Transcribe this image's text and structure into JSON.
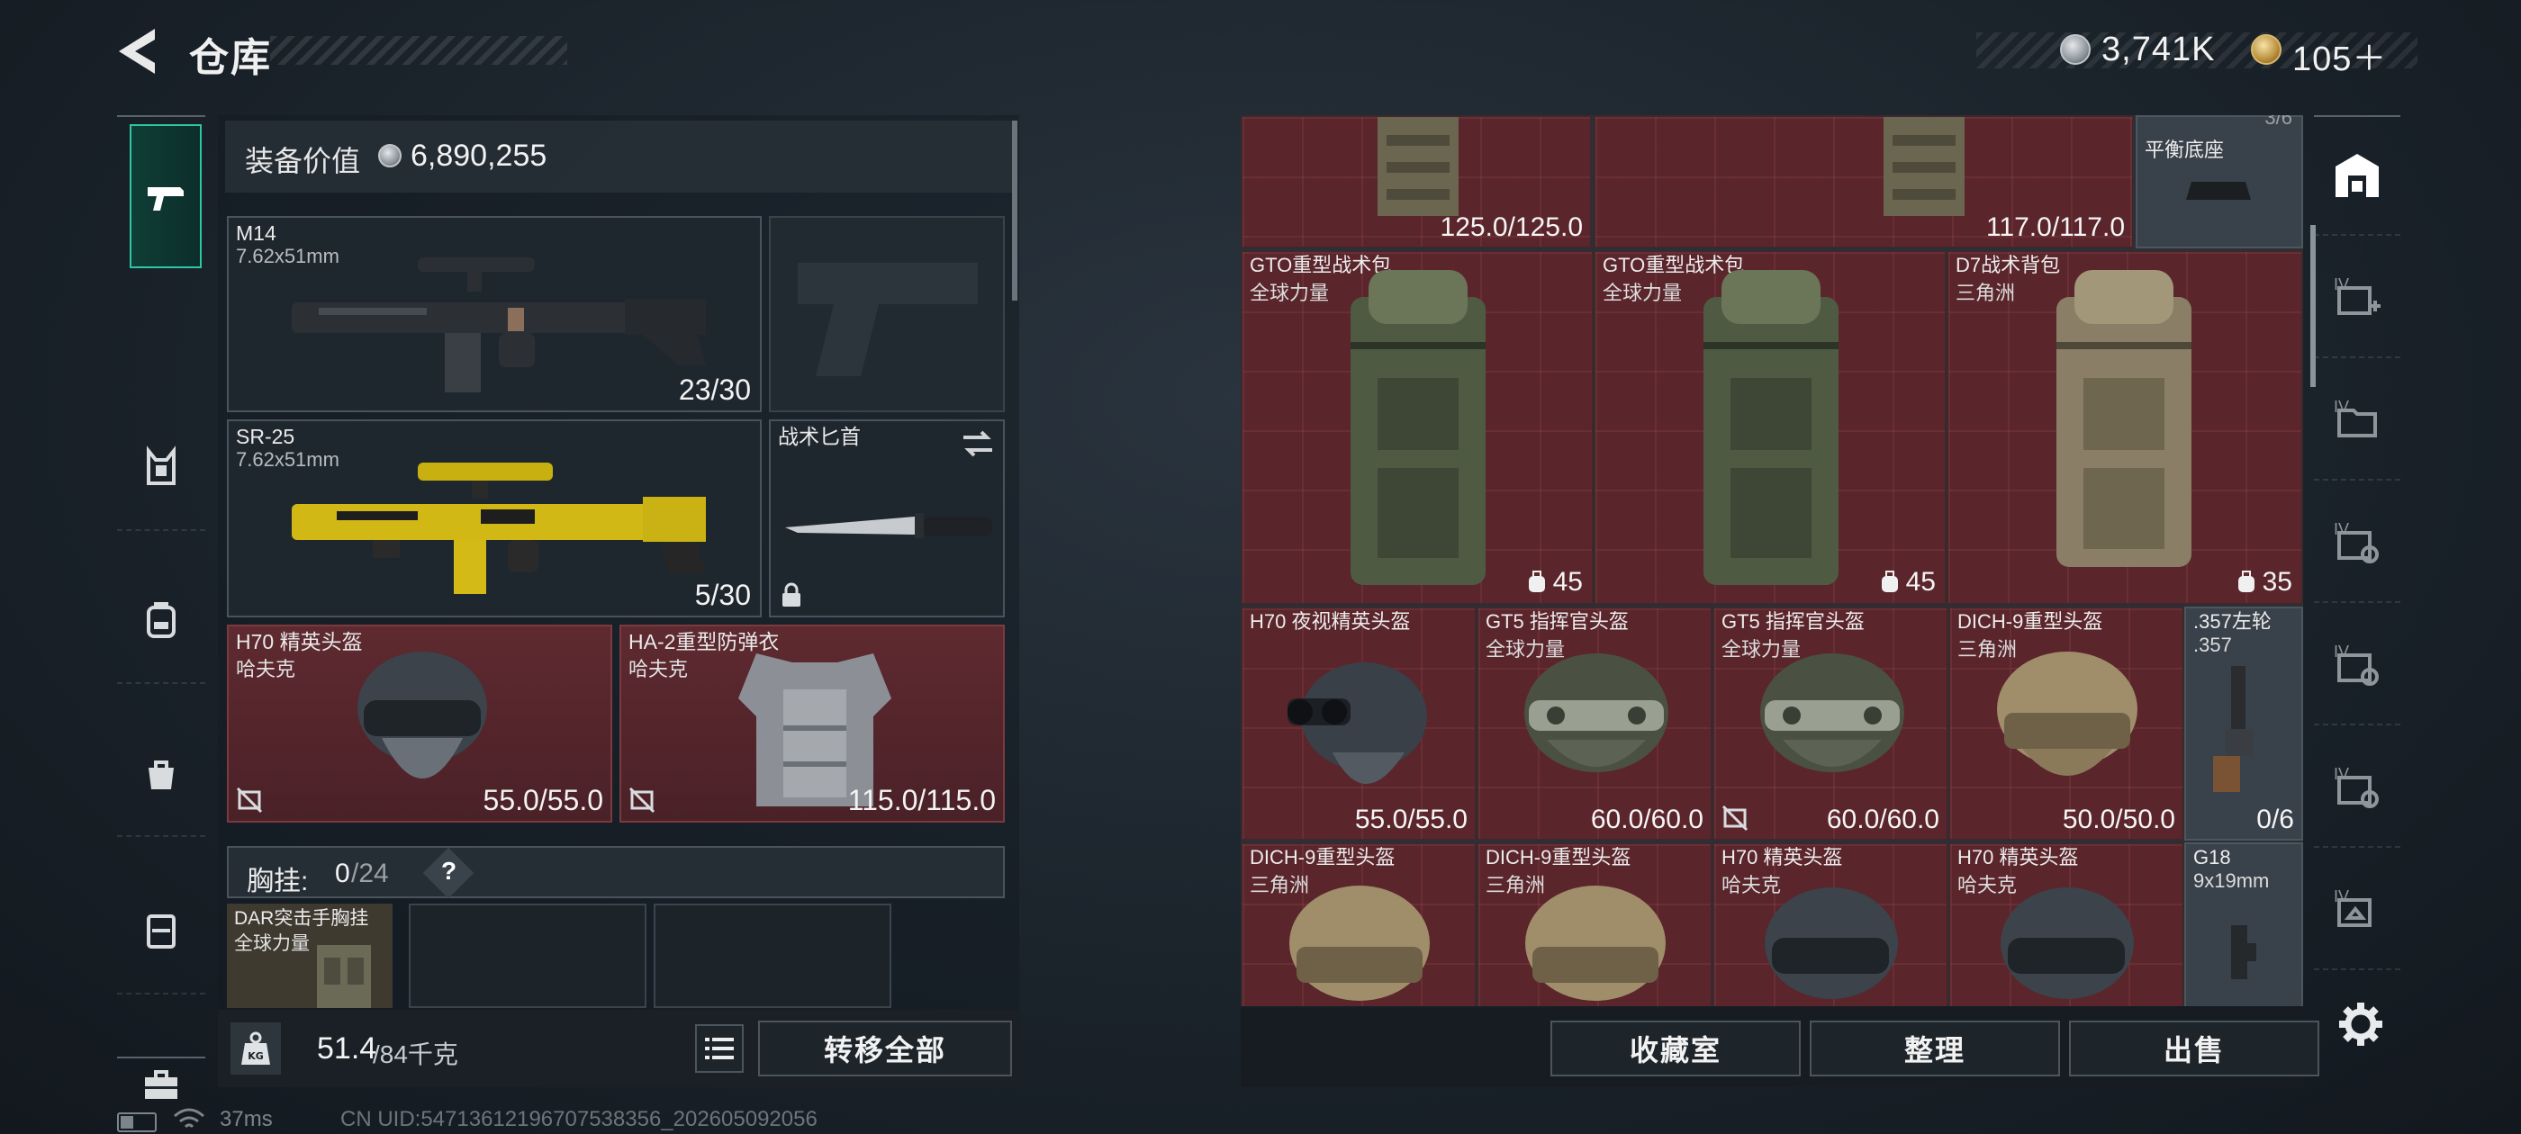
{
  "header": {
    "title": "仓库",
    "currency": [
      {
        "icon": "silver-coin-icon",
        "value": "3,741K"
      },
      {
        "icon": "gold-coin-icon",
        "value": "105＋"
      }
    ]
  },
  "left_tabs": [
    {
      "icon": "pistol-icon",
      "active": true
    },
    {
      "icon": "vest-icon",
      "active": false
    },
    {
      "icon": "backpack-icon",
      "active": false
    },
    {
      "icon": "bag-icon",
      "active": false
    },
    {
      "icon": "case-icon",
      "active": false
    },
    {
      "icon": "toolbox-icon",
      "active": false
    }
  ],
  "loadout": {
    "value_label": "装备价值",
    "value": "6,890,255",
    "primary": {
      "name": "M14",
      "caliber": "7.62x51mm",
      "ammo": "23/30"
    },
    "secondary": {
      "name": "SR-25",
      "caliber": "7.62x51mm",
      "ammo": "5/30"
    },
    "melee": {
      "name": "战术匕首"
    },
    "helmet": {
      "name": "H70 精英头盔",
      "origin": "哈夫克",
      "durability": "55.0/55.0"
    },
    "armor": {
      "name": "HA-2重型防弹衣",
      "origin": "哈夫克",
      "durability": "115.0/115.0"
    },
    "chest_rig": {
      "label": "胸挂:",
      "count": "0",
      "capacity": "/24",
      "help": "?",
      "item_name": "DAR突击手胸挂",
      "item_origin": "全球力量"
    },
    "weight": {
      "current": "51.4",
      "max": "/84千克",
      "kg_label": "KG"
    },
    "transfer_all": "转移全部"
  },
  "storage": {
    "top_row": [
      {
        "durability": "125.0/125.0"
      },
      {
        "durability": "117.0/117.0"
      }
    ],
    "top_right": {
      "name": "平衡底座",
      "hint": "3/6"
    },
    "backpacks": [
      {
        "name": "GTO重型战术包",
        "origin": "全球力量",
        "capacity": "45"
      },
      {
        "name": "GTO重型战术包",
        "origin": "全球力量",
        "capacity": "45"
      },
      {
        "name": "D7战术背包",
        "origin": "三角洲",
        "capacity": "35"
      }
    ],
    "helmets_row1": [
      {
        "name": "H70 夜视精英头盔",
        "origin": "",
        "durability": "55.0/55.0",
        "locked": false
      },
      {
        "name": "GT5 指挥官头盔",
        "origin": "全球力量",
        "durability": "60.0/60.0",
        "locked": false
      },
      {
        "name": "GT5 指挥官头盔",
        "origin": "全球力量",
        "durability": "60.0/60.0",
        "locked": true
      },
      {
        "name": "DICH-9重型头盔",
        "origin": "三角洲",
        "durability": "50.0/50.0",
        "locked": false
      }
    ],
    "side_item1": {
      "name": ".357左轮",
      "caliber": ".357",
      "ammo": "0/6"
    },
    "helmets_row2": [
      {
        "name": "DICH-9重型头盔",
        "origin": "三角洲"
      },
      {
        "name": "DICH-9重型头盔",
        "origin": "三角洲"
      },
      {
        "name": "H70 精英头盔",
        "origin": "哈夫克"
      },
      {
        "name": "H70 精英头盔",
        "origin": "哈夫克"
      }
    ],
    "side_item2": {
      "name": "G18",
      "caliber": "9x19mm"
    },
    "buttons": {
      "collection": "收藏室",
      "sort": "整理",
      "sell": "出售"
    }
  },
  "right_tabs": [
    {
      "icon": "stash-icon",
      "tier": ""
    },
    {
      "icon": "stash-expand-icon",
      "tier": "IV"
    },
    {
      "icon": "stash-folder-icon",
      "tier": "IV"
    },
    {
      "icon": "stash-wrench-icon",
      "tier": "IV"
    },
    {
      "icon": "stash-wrench-icon",
      "tier": "IV"
    },
    {
      "icon": "stash-wrench-icon",
      "tier": "IV"
    },
    {
      "icon": "stash-medic-icon",
      "tier": "IV"
    }
  ],
  "footer": {
    "latency": "37ms",
    "uid": "CN UID:5471361219670753835​6_202605092056"
  },
  "colors": {
    "accent": "#2fc6a6",
    "slot_red": "#5a252b"
  }
}
